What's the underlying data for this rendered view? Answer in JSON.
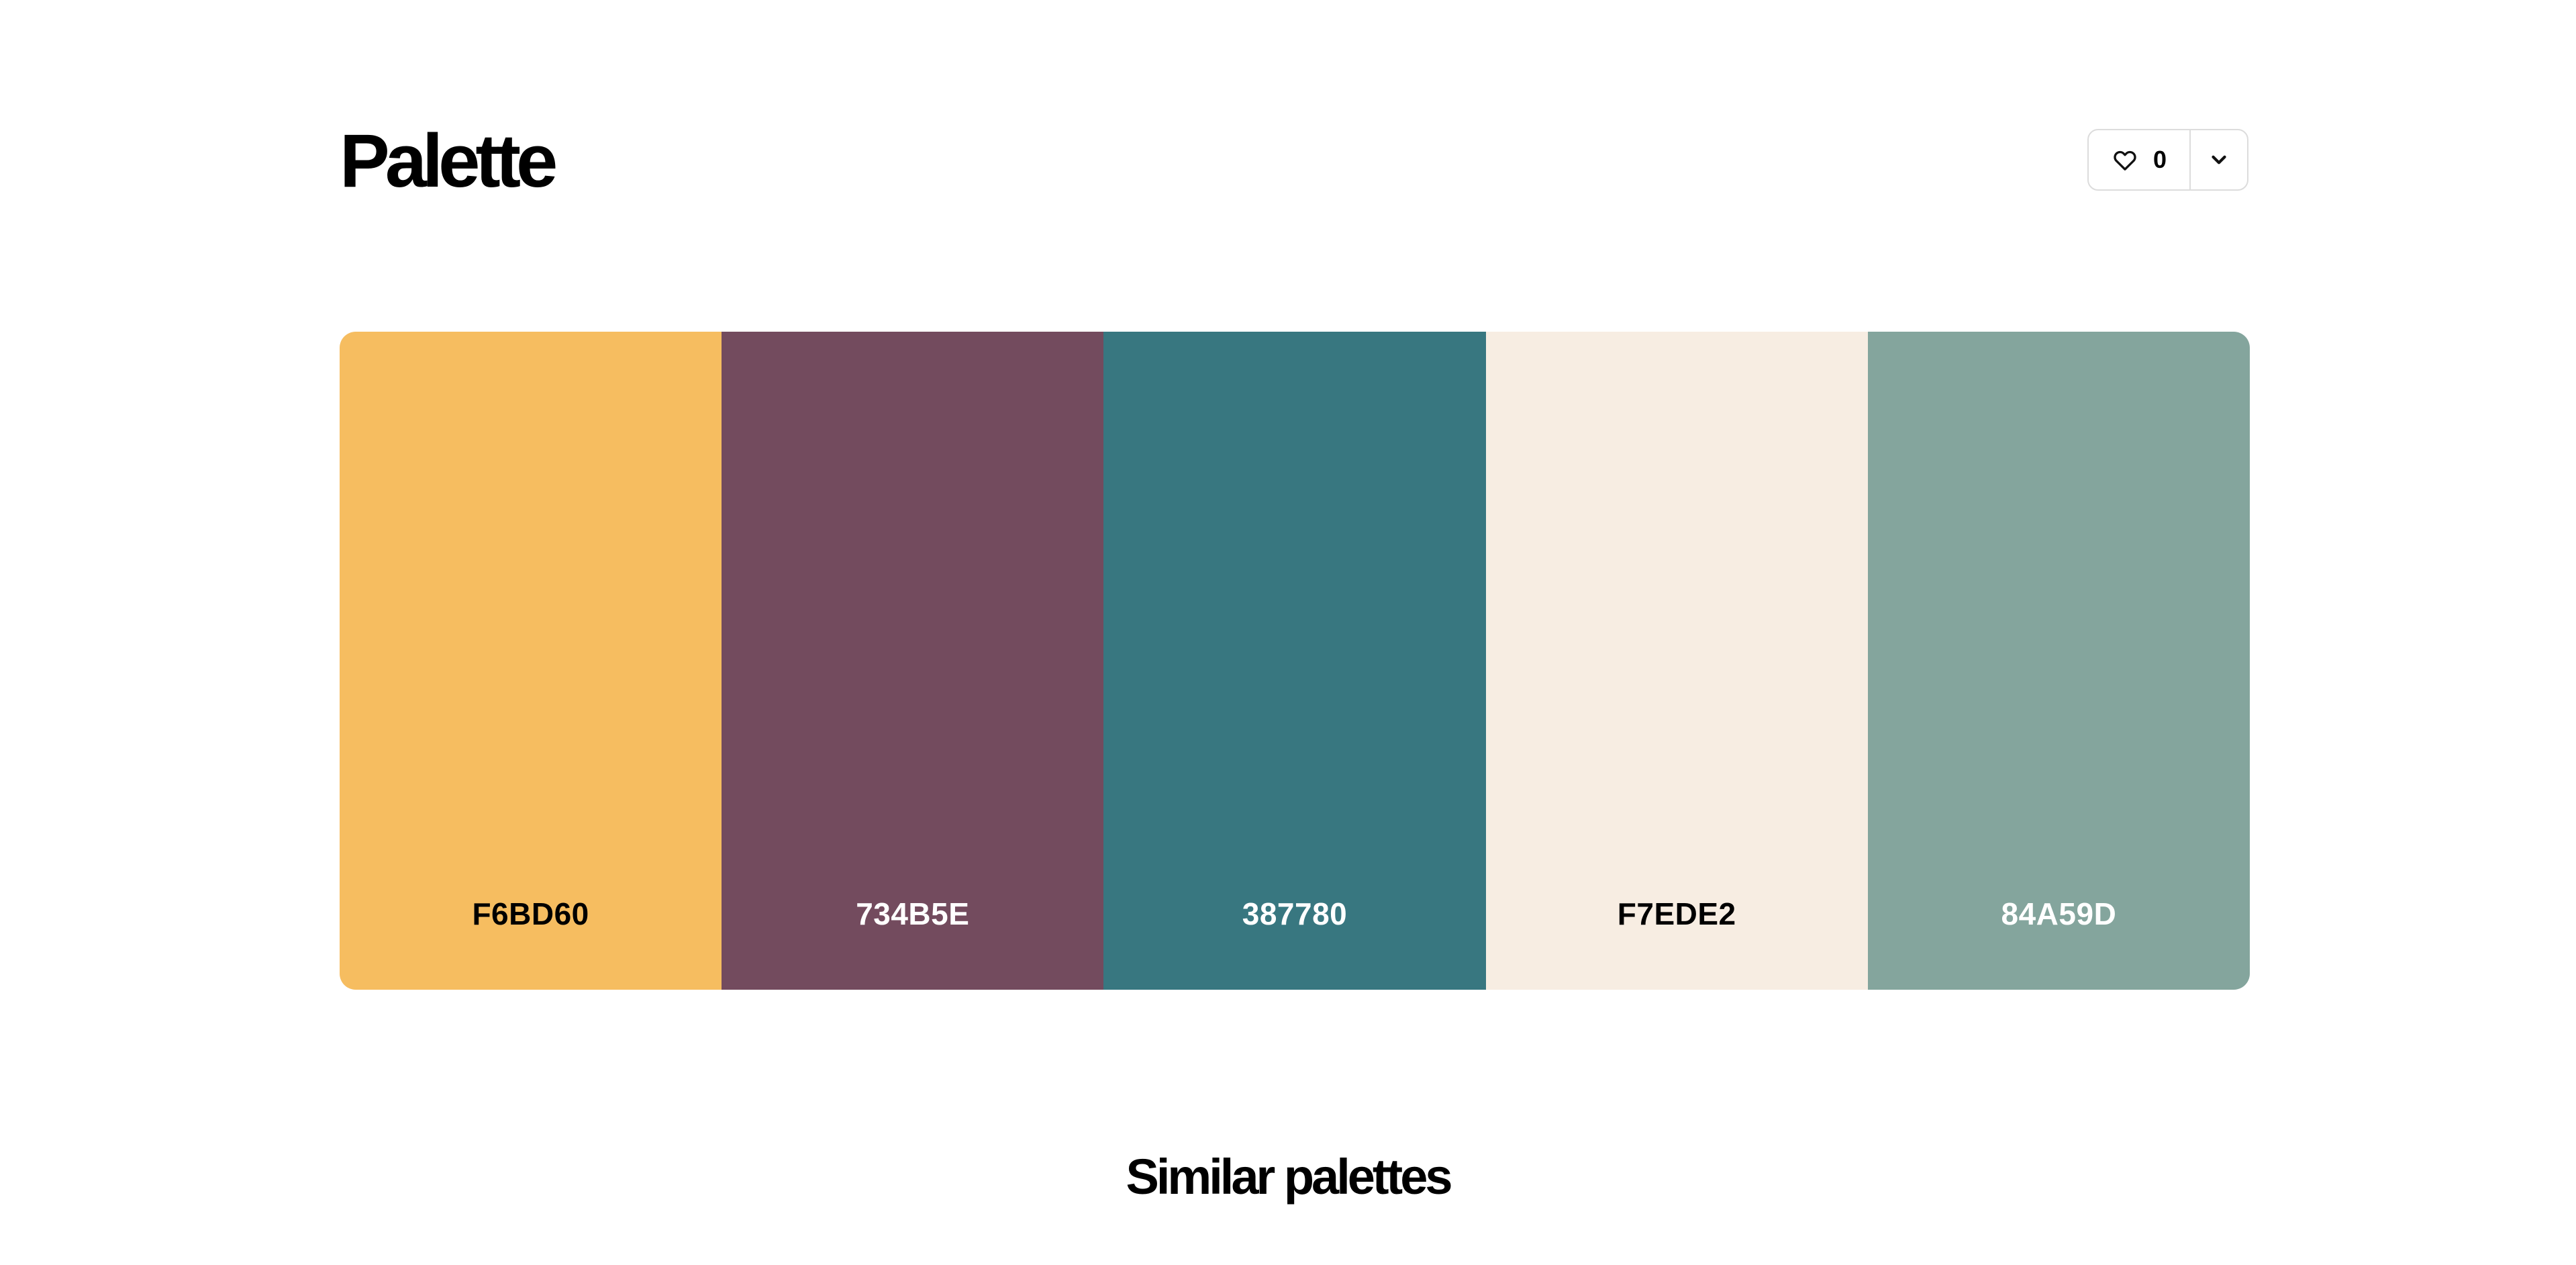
{
  "header": {
    "title": "Palette",
    "like_count": "0"
  },
  "icons": {
    "like": "heart-outline-icon",
    "more": "chevron-down-icon"
  },
  "palette": {
    "colors": [
      {
        "code": "F6BD60",
        "hex": "#F6BD60",
        "text_color": "#000000"
      },
      {
        "code": "734B5E",
        "hex": "#734B5E",
        "text_color": "#FFFFFF"
      },
      {
        "code": "387780",
        "hex": "#387780",
        "text_color": "#FFFFFF"
      },
      {
        "code": "F7EDE2",
        "hex": "#F7EDE2",
        "text_color": "#000000"
      },
      {
        "code": "84A59D",
        "hex": "#84A59D",
        "text_color": "#FFFFFF"
      }
    ]
  },
  "similar": {
    "title": "Similar palettes"
  }
}
